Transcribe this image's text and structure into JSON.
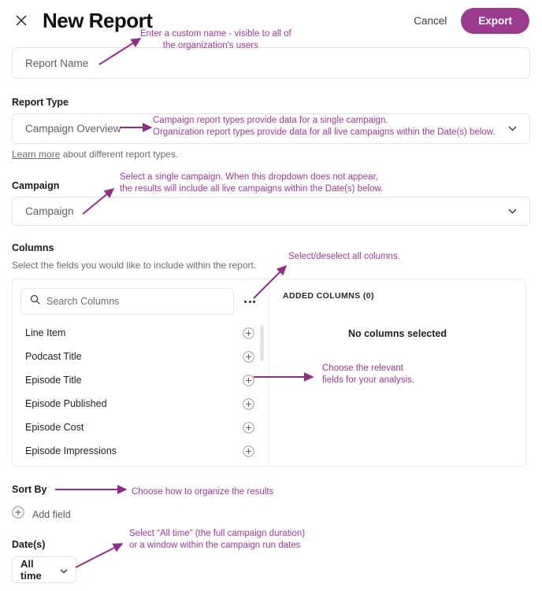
{
  "header": {
    "close_icon": "close-x-icon",
    "title": "New Report",
    "cancel_label": "Cancel",
    "export_label": "Export",
    "export_color": "#9b3a8e"
  },
  "report_name": {
    "placeholder": "Report Name",
    "value": ""
  },
  "report_type": {
    "label": "Report Type",
    "value": "Campaign Overview",
    "chevron_icon": "chevron-down-icon",
    "learn_more_link": "Learn more",
    "learn_more_rest": " about different report types."
  },
  "campaign": {
    "label": "Campaign",
    "placeholder": "Campaign",
    "chevron_icon": "chevron-down-icon"
  },
  "columns": {
    "label": "Columns",
    "helper": "Select the fields you would like to include within the report.",
    "search_placeholder": "Search Columns",
    "search_icon": "search-icon",
    "overflow_icon": "more-options-dots-icon",
    "available": [
      {
        "name": "Line Item",
        "add_icon": "plus-circle-icon"
      },
      {
        "name": "Podcast Title",
        "add_icon": "plus-circle-icon"
      },
      {
        "name": "Episode Title",
        "add_icon": "plus-circle-icon"
      },
      {
        "name": "Episode Published",
        "add_icon": "plus-circle-icon"
      },
      {
        "name": "Episode Cost",
        "add_icon": "plus-circle-icon"
      },
      {
        "name": "Episode Impressions",
        "add_icon": "plus-circle-icon"
      }
    ],
    "added_header": "ADDED COLUMNS (0)",
    "added_count": 0,
    "empty_state": "No columns selected"
  },
  "sort_by": {
    "label": "Sort By",
    "add_field_label": "Add field",
    "add_icon": "plus-circle-icon"
  },
  "dates": {
    "label": "Date(s)",
    "value": "All time",
    "chevron_icon": "chevron-down-icon"
  },
  "annotations": {
    "color": "#a0399a",
    "items": [
      {
        "text": "Enter a custom name - visible to all of\n         the organization's users"
      },
      {
        "text": "Campaign report types provide data for a single campaign.\nOrganization report types provide data for all live campaigns within the Date(s) below."
      },
      {
        "text": "Select a single campaign. When this dropdown does not appear,\nthe results will include all live campaigns within the Date(s) below."
      },
      {
        "text": "Select/deselect all columns."
      },
      {
        "text": "Choose the relevant\nfields for your analysis."
      },
      {
        "text": "Choose how to organize the results"
      },
      {
        "text": "Select “All time” (the full campaign duration)\nor a window within the campaign run dates"
      }
    ]
  }
}
